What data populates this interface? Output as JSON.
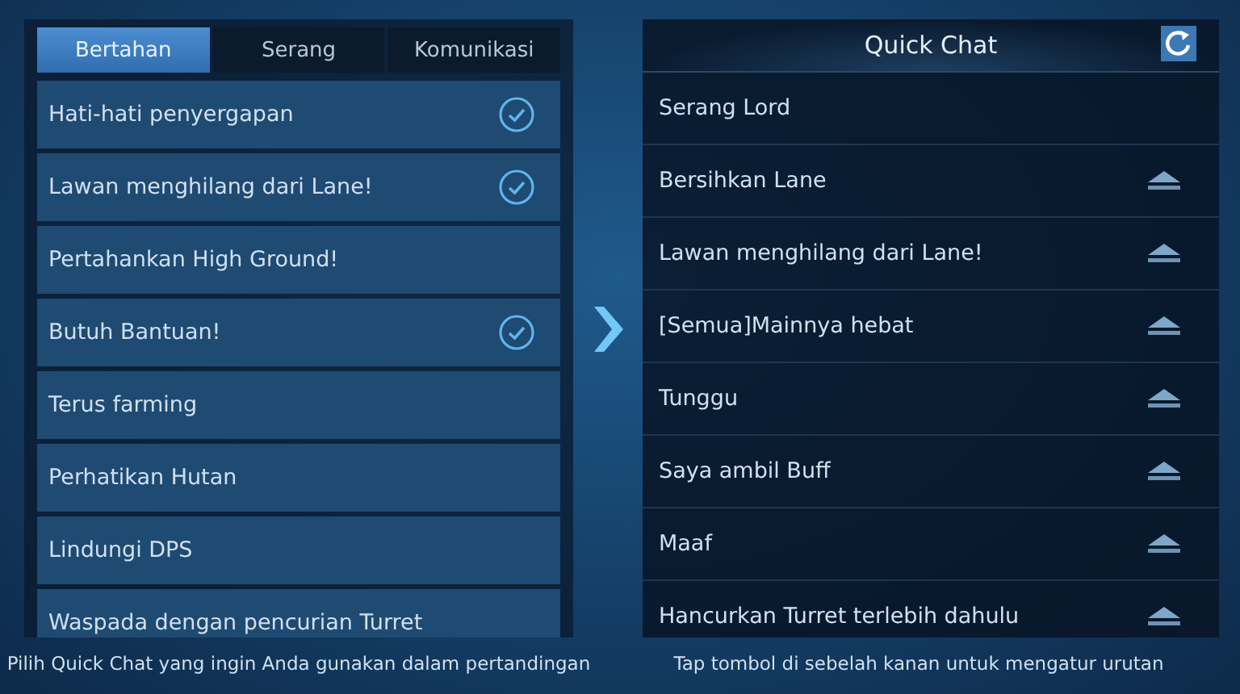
{
  "tabs": [
    {
      "label": "Bertahan",
      "selected": true
    },
    {
      "label": "Serang",
      "selected": false
    },
    {
      "label": "Komunikasi",
      "selected": false
    }
  ],
  "options": [
    {
      "label": "Hati-hati penyergapan",
      "checked": true
    },
    {
      "label": "Lawan menghilang dari Lane!",
      "checked": true
    },
    {
      "label": "Pertahankan High Ground!",
      "checked": false
    },
    {
      "label": "Butuh Bantuan!",
      "checked": true
    },
    {
      "label": "Terus farming",
      "checked": false
    },
    {
      "label": "Perhatikan Hutan",
      "checked": false
    },
    {
      "label": "Lindungi DPS",
      "checked": false
    },
    {
      "label": "Waspada dengan pencurian Turret",
      "checked": false
    }
  ],
  "left_hint": "Pilih Quick Chat yang ingin Anda gunakan dalam pertandingan",
  "quick_chat": {
    "title": "Quick Chat",
    "items": [
      {
        "label": "Serang Lord",
        "movable": false
      },
      {
        "label": "Bersihkan Lane",
        "movable": true
      },
      {
        "label": "Lawan menghilang dari Lane!",
        "movable": true
      },
      {
        "label": "[Semua]Mainnya hebat",
        "movable": true
      },
      {
        "label": "Tunggu",
        "movable": true
      },
      {
        "label": "Saya ambil Buff",
        "movable": true
      },
      {
        "label": "Maaf",
        "movable": true
      },
      {
        "label": "Hancurkan Turret terlebih dahulu",
        "movable": true
      }
    ]
  },
  "right_hint": "Tap tombol di sebelah kanan untuk mengatur urutan"
}
